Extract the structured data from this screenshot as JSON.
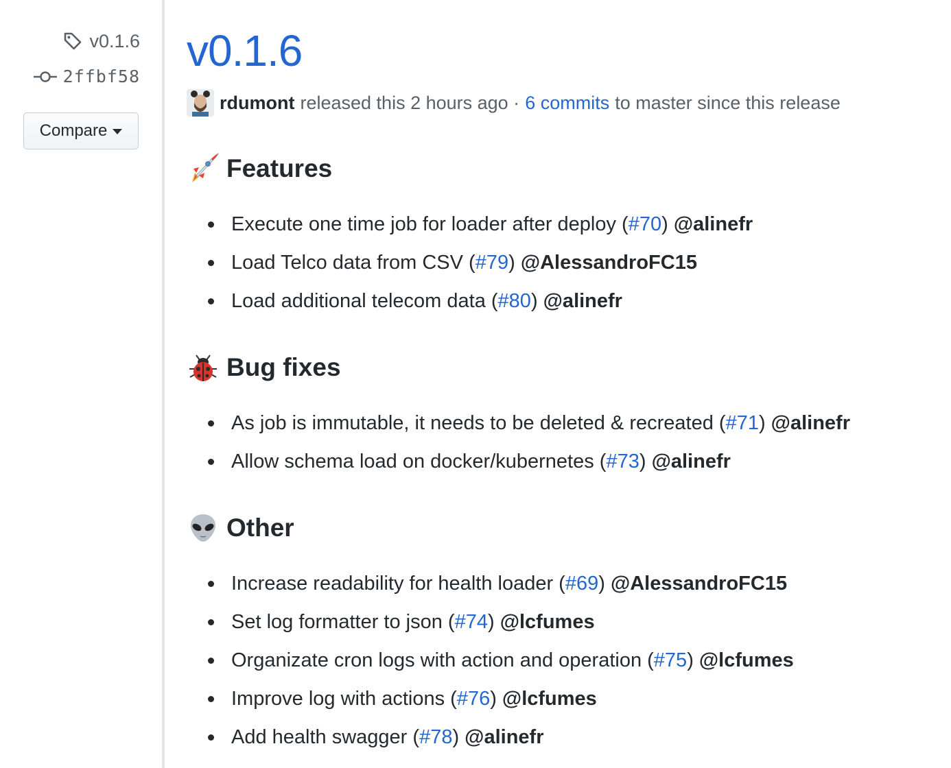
{
  "sidebar": {
    "tag_label": "v0.1.6",
    "commit_sha": "2ffbf58",
    "compare_label": "Compare"
  },
  "release": {
    "title": "v0.1.6",
    "author": "rdumont",
    "released_text": "released this 2 hours ago ·",
    "commits_link": "6 commits",
    "commits_suffix": "to master since this release"
  },
  "sections": [
    {
      "title": "Features",
      "icon": "rocket-emoji",
      "items": [
        {
          "text": "Execute one time job for loader after deploy (",
          "pr": "#70",
          "author": "@alinefr"
        },
        {
          "text": "Load Telco data from CSV (",
          "pr": "#79",
          "author": "@AlessandroFC15"
        },
        {
          "text": "Load additional telecom data (",
          "pr": "#80",
          "author": "@alinefr"
        }
      ]
    },
    {
      "title": "Bug fixes",
      "icon": "ladybug-emoji",
      "items": [
        {
          "text": "As job is immutable, it needs to be deleted & recreated (",
          "pr": "#71",
          "author": "@alinefr"
        },
        {
          "text": "Allow schema load on docker/kubernetes (",
          "pr": "#73",
          "author": "@alinefr"
        }
      ]
    },
    {
      "title": "Other",
      "icon": "alien-emoji",
      "items": [
        {
          "text": "Increase readability for health loader (",
          "pr": "#69",
          "author": "@AlessandroFC15"
        },
        {
          "text": "Set log formatter to json (",
          "pr": "#74",
          "author": "@lcfumes"
        },
        {
          "text": "Organizate cron logs with action and operation (",
          "pr": "#75",
          "author": "@lcfumes"
        },
        {
          "text": "Improve log with actions (",
          "pr": "#76",
          "author": "@lcfumes"
        },
        {
          "text": "Add health swagger (",
          "pr": "#78",
          "author": "@alinefr"
        }
      ]
    }
  ],
  "colors": {
    "link": "#2366d1",
    "text": "#24292e",
    "muted": "#586069"
  }
}
